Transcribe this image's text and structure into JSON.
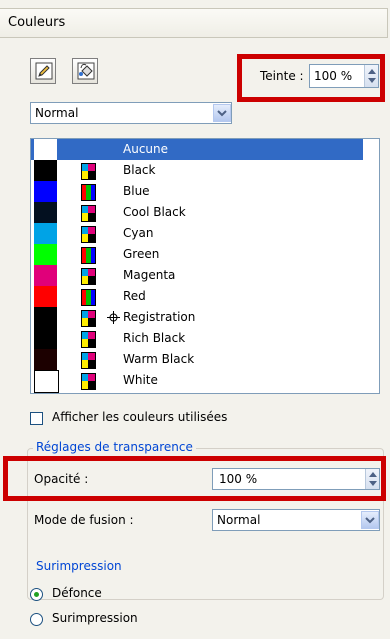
{
  "panel": {
    "title": "Couleurs"
  },
  "tint": {
    "label": "Teinte :",
    "value": "100 %"
  },
  "blend_top": {
    "value": "Normal"
  },
  "swatches": [
    {
      "name": "Aucune",
      "color": "#ffffff",
      "selected": true
    },
    {
      "name": "Black",
      "color": "#000000"
    },
    {
      "name": "Blue",
      "color": "#0000ff"
    },
    {
      "name": "Cool Black",
      "color": "#031020"
    },
    {
      "name": "Cyan",
      "color": "#00a3e6"
    },
    {
      "name": "Green",
      "color": "#00ff00"
    },
    {
      "name": "Magenta",
      "color": "#e0007a"
    },
    {
      "name": "Red",
      "color": "#ff0000"
    },
    {
      "name": "Registration",
      "color": "#000000"
    },
    {
      "name": "Rich Black",
      "color": "#000000"
    },
    {
      "name": "Warm Black",
      "color": "#1c0000"
    },
    {
      "name": "White",
      "color": "#ffffff"
    }
  ],
  "show_used": {
    "label": "Afficher les couleurs utilisées"
  },
  "transparency": {
    "legend": "Réglages de transparence",
    "opacity_label": "Opacité :",
    "opacity_value": "100 %",
    "blend_label": "Mode de fusion :",
    "blend_value": "Normal"
  },
  "overprint": {
    "legend": "Surimpression",
    "option1": "Défonce",
    "option2": "Surimpression",
    "selected": "Défonce"
  },
  "colors": {
    "highlight": "#cc0000",
    "selection": "#316ac5",
    "legend": "#0046d5"
  }
}
